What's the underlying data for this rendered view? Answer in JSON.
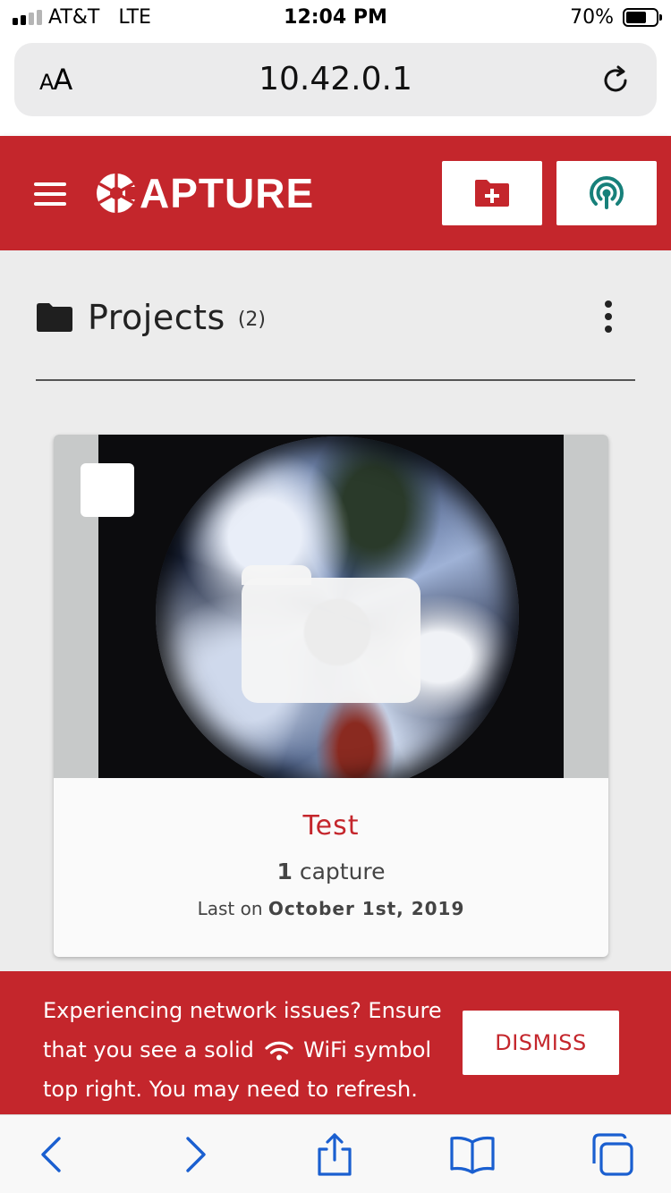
{
  "status_bar": {
    "carrier": "AT&T",
    "network": "LTE",
    "time": "12:04 PM",
    "battery_percent": "70%",
    "battery_level": 0.7,
    "signal_bars_active": 2,
    "signal_bars_total": 4
  },
  "browser": {
    "text_size_label": "AA",
    "url": "10.42.0.1",
    "reload_icon": "reload-icon"
  },
  "header": {
    "logo_text": "APTURE",
    "menu_icon": "hamburger-menu-icon",
    "new_project_icon": "folder-plus-icon",
    "connection_icon": "wifi-signal-icon"
  },
  "projects": {
    "title": "Projects",
    "count": "(2)",
    "items": [
      {
        "name": "Test",
        "capture_count": "1",
        "capture_label": "capture",
        "last_label": "Last on",
        "last_date": "October 1st, 2019"
      }
    ]
  },
  "banner": {
    "message_part1": "Experiencing network issues? Ensure that you see a solid",
    "message_part2": "WiFi symbol top right. You may need to refresh.",
    "dismiss_label": "DISMISS"
  },
  "toolbar": {
    "icons": [
      "back-icon",
      "forward-icon",
      "share-icon",
      "bookmarks-icon",
      "tabs-icon"
    ]
  },
  "colors": {
    "brand_red": "#c4262c",
    "teal_icon": "#17807a",
    "ios_blue": "#1a5fd0",
    "content_bg": "#ececec"
  }
}
